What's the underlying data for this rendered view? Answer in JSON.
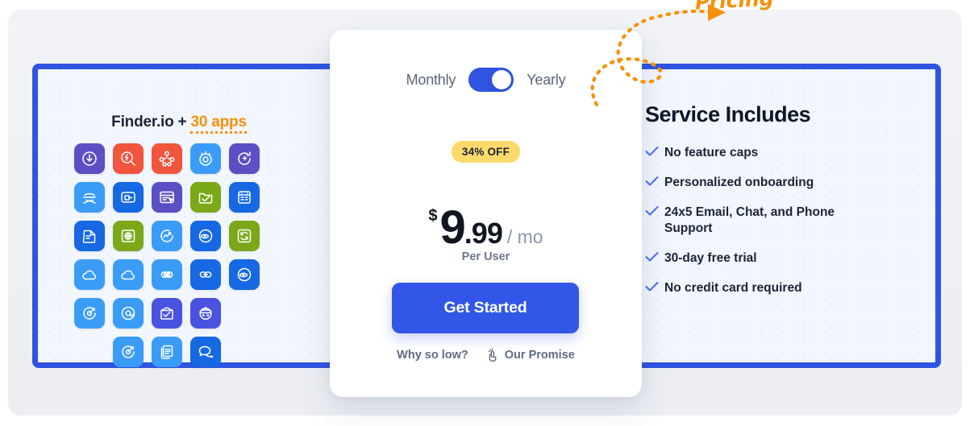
{
  "annotation": {
    "label": "Pricing",
    "color": "#f79009",
    "arrow_icon": "dotted-curved-arrow-icon"
  },
  "left_panel": {
    "heading_brand": "Finder.io",
    "heading_plus": "+",
    "heading_count": "30 apps",
    "border_color": "#2f55e0",
    "apps": [
      {
        "name": "app-icon-1",
        "color": "#5b4fc4",
        "glyph": "download-clock-icon"
      },
      {
        "name": "app-icon-2",
        "color": "#f2553d",
        "glyph": "search-bolt-icon"
      },
      {
        "name": "app-icon-3",
        "color": "#f2553d",
        "glyph": "molecule-icon"
      },
      {
        "name": "app-icon-4",
        "color": "#3b9cf7",
        "glyph": "target-sparkle-icon"
      },
      {
        "name": "app-icon-5",
        "color": "#5b4fc4",
        "glyph": "refresh-plus-icon"
      },
      {
        "name": "app-icon-6",
        "color": "#3b9cf7",
        "glyph": "ninja-icon"
      },
      {
        "name": "app-icon-7",
        "color": "#1668e3",
        "glyph": "device-window-icon"
      },
      {
        "name": "app-icon-8",
        "color": "#5b4fc4",
        "glyph": "browser-click-icon"
      },
      {
        "name": "app-icon-9",
        "color": "#7aa818",
        "glyph": "folder-check-icon"
      },
      {
        "name": "app-icon-10",
        "color": "#1668e3",
        "glyph": "clipboard-list-icon"
      },
      {
        "name": "app-icon-11",
        "color": "#1668e3",
        "glyph": "document-fold-icon"
      },
      {
        "name": "app-icon-12",
        "color": "#7aa818",
        "glyph": "globe-frame-icon"
      },
      {
        "name": "app-icon-13",
        "color": "#3b9cf7",
        "glyph": "chart-curve-icon"
      },
      {
        "name": "app-icon-14",
        "color": "#1668e3",
        "glyph": "eye-refresh-icon"
      },
      {
        "name": "app-icon-15",
        "color": "#7aa818",
        "glyph": "sync-frame-icon"
      },
      {
        "name": "app-icon-16",
        "color": "#3b9cf7",
        "glyph": "cloud-icon"
      },
      {
        "name": "app-icon-17",
        "color": "#3b9cf7",
        "glyph": "cloud-icon"
      },
      {
        "name": "app-icon-18",
        "color": "#3b9cf7",
        "glyph": "infinity-icon"
      },
      {
        "name": "app-icon-19",
        "color": "#1668e3",
        "glyph": "link-chain-icon"
      },
      {
        "name": "app-icon-20",
        "color": "#1668e3",
        "glyph": "eye-refresh-icon"
      },
      {
        "name": "app-icon-21",
        "color": "#3b9cf7",
        "glyph": "target-arrow-icon"
      },
      {
        "name": "app-icon-22",
        "color": "#3b9cf7",
        "glyph": "at-sign-icon"
      },
      {
        "name": "app-icon-23",
        "color": "#4a53e0",
        "glyph": "mail-check-icon"
      },
      {
        "name": "app-icon-24",
        "color": "#4a53e0",
        "glyph": "bot-face-icon"
      }
    ],
    "apps_last_row": [
      {
        "name": "app-icon-25",
        "color": "#3b9cf7",
        "glyph": "target-arrow-icon"
      },
      {
        "name": "app-icon-26",
        "color": "#3b9cf7",
        "glyph": "copy-docs-icon"
      },
      {
        "name": "app-icon-27",
        "color": "#1668e3",
        "glyph": "chat-bubbles-icon"
      }
    ]
  },
  "pricing_card": {
    "toggle": {
      "left_label": "Monthly",
      "right_label": "Yearly",
      "state": "yearly",
      "color": "#2f55e0"
    },
    "discount_badge": "34% OFF",
    "badge_color": "#fcd96b",
    "currency": "$",
    "amount_int": "9",
    "amount_dec": ".99",
    "period": "/ mo",
    "per_user": "Per User",
    "cta_label": "Get Started",
    "cta_color": "#3257e8",
    "links": [
      {
        "name": "why-so-low-link",
        "label": "Why so low?",
        "icon": ""
      },
      {
        "name": "our-promise-link",
        "label": "Our Promise",
        "icon": "hand-promise-icon"
      }
    ]
  },
  "service_panel": {
    "title": "Service Includes",
    "check_color": "#4a6df0",
    "items": [
      "No feature caps",
      "Personalized onboarding",
      "24x5 Email, Chat, and Phone Support",
      "30-day free trial",
      "No credit card required"
    ]
  }
}
